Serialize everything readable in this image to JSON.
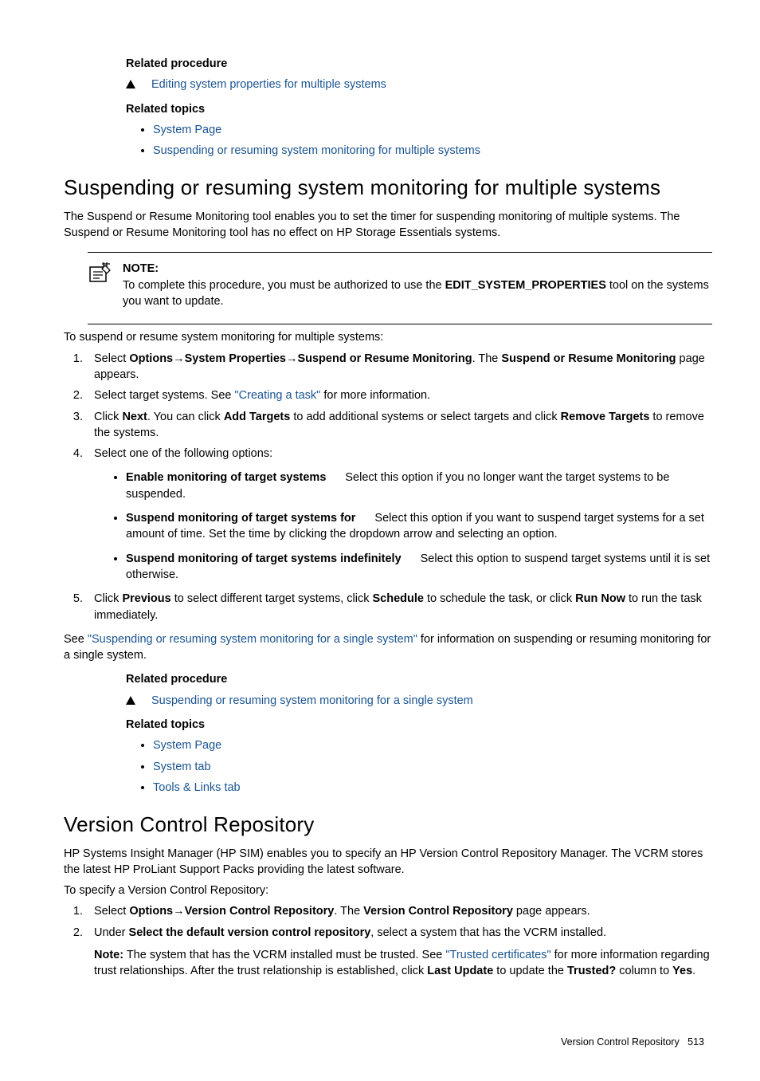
{
  "top": {
    "related_procedure_heading": "Related procedure",
    "related_procedure_link": "Editing system properties for multiple systems",
    "related_topics_heading": "Related topics",
    "topic1": "System Page",
    "topic2": "Suspending or resuming system monitoring for multiple systems"
  },
  "section1": {
    "heading": "Suspending or resuming system monitoring for multiple systems",
    "intro": "The Suspend or Resume Monitoring tool enables you to set the timer for suspending monitoring of multiple systems. The Suspend or Resume Monitoring tool has no effect on HP Storage Essentials systems.",
    "note_label": "NOTE:",
    "note_body_1": "To complete this procedure, you must be authorized to use the ",
    "note_bold": "EDIT_SYSTEM_PROPERTIES",
    "note_body_2": " tool on the systems you want to update.",
    "leadin": "To suspend or resume system monitoring for multiple systems:",
    "step1_a": "Select ",
    "step1_b1": "Options",
    "step1_arrow": "→",
    "step1_b2": "System Properties",
    "step1_b3": "Suspend or Resume Monitoring",
    "step1_c": ". The ",
    "step1_d": "Suspend or Resume Monitoring",
    "step1_e": " page appears.",
    "step2_a": "Select target systems. See ",
    "step2_link": "\"Creating a task\"",
    "step2_b": " for more information.",
    "step3_a": "Click ",
    "step3_b": "Next",
    "step3_c": ". You can click ",
    "step3_d": "Add Targets",
    "step3_e": " to add additional systems or select targets and click ",
    "step3_f": "Remove Targets",
    "step3_g": " to remove the systems.",
    "step4": "Select one of the following options:",
    "opt1_b": "Enable monitoring of target systems",
    "opt1_t": "Select this option if you no longer want the target systems to be suspended.",
    "opt2_b": "Suspend monitoring of target systems for",
    "opt2_t": "Select this option if you want to suspend target systems for a set amount of time. Set the time by clicking the dropdown arrow and selecting an option.",
    "opt3_b": "Suspend monitoring of target systems indefinitely",
    "opt3_t": "Select this option to suspend target systems until it is set otherwise.",
    "step5_a": "Click ",
    "step5_b": "Previous",
    "step5_c": " to select different target systems, click ",
    "step5_d": "Schedule",
    "step5_e": " to schedule the task, or click ",
    "step5_f": "Run Now",
    "step5_g": " to run the task immediately.",
    "see_a": "See ",
    "see_link": "\"Suspending or resuming system monitoring for a single system\"",
    "see_b": " for information on suspending or resuming monitoring for a single system.",
    "rp_heading": "Related procedure",
    "rp_link": "Suspending or resuming system monitoring for a single system",
    "rt_heading": "Related topics",
    "rt1": "System Page",
    "rt2": "System tab",
    "rt3": "Tools & Links tab"
  },
  "section2": {
    "heading": "Version Control Repository",
    "intro": "HP Systems Insight Manager (HP SIM) enables you to specify an HP Version Control Repository Manager. The VCRM stores the latest HP ProLiant Support Packs providing the latest software.",
    "leadin": "To specify a Version Control Repository:",
    "step1_a": "Select ",
    "step1_b1": "Options",
    "step1_arrow": "→",
    "step1_b2": "Version Control Repository",
    "step1_c": ". The ",
    "step1_d": "Version Control Repository",
    "step1_e": " page appears.",
    "step2_a": "Under ",
    "step2_b": "Select the default version control repository",
    "step2_c": ", select a system that has the VCRM installed.",
    "note_a": "Note:",
    "note_b": " The system that has the VCRM installed must be trusted. See ",
    "note_link": "\"Trusted certificates\"",
    "note_c": " for more information regarding trust relationships. After the trust relationship is established, click ",
    "note_d": "Last Update",
    "note_e": " to update the ",
    "note_f": "Trusted?",
    "note_g": " column to ",
    "note_h": "Yes",
    "note_i": "."
  },
  "footer": {
    "text": "Version Control Repository",
    "page": "513"
  }
}
